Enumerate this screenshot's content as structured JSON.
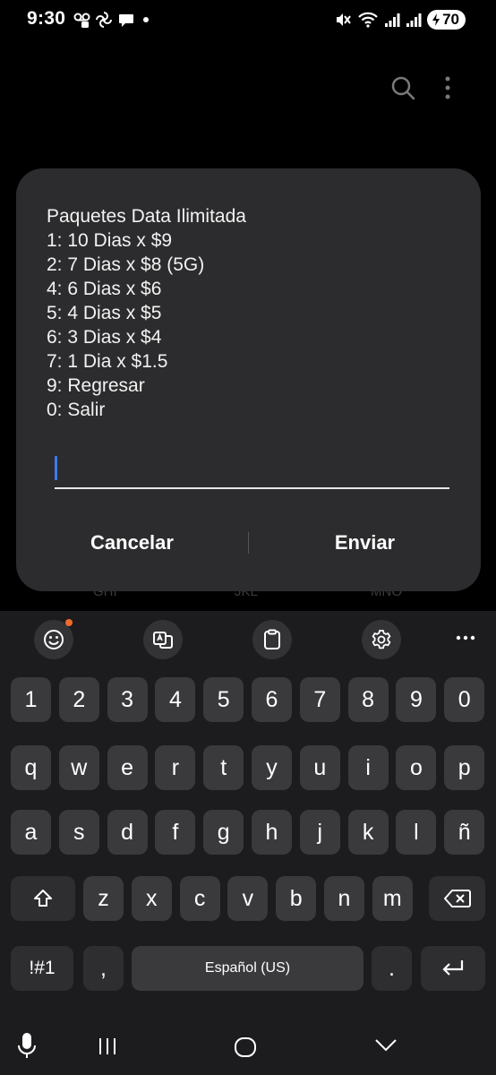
{
  "status_bar": {
    "time": "9:30",
    "battery_level": "70",
    "icons": [
      "voicemail-icon",
      "pinwheel-icon",
      "chat-bubble-icon",
      "dot-icon",
      "mute-icon",
      "wifi-icon",
      "signal-icon",
      "signal-icon",
      "battery-charging-icon"
    ]
  },
  "app_header": {
    "icons": [
      "search-icon",
      "more-vertical-icon"
    ]
  },
  "dialog": {
    "lines": [
      "Paquetes Data Ilimitada",
      "1: 10 Dias x $9",
      "2: 7 Dias x $8 (5G)",
      "4: 6 Dias x $6",
      "5: 4 Dias x $5",
      "6: 3 Dias x $4",
      "7: 1 Dia x $1.5",
      "9: Regresar",
      "0: Salir"
    ],
    "input_value": "",
    "cancel_label": "Cancelar",
    "send_label": "Enviar"
  },
  "background_dialpad": {
    "letters": [
      "GHI",
      "JKL",
      "MNO"
    ]
  },
  "keyboard": {
    "toolbar": [
      "emoji-icon",
      "translate-icon",
      "clipboard-icon",
      "gear-icon",
      "more-horizontal-icon"
    ],
    "row_numbers": [
      "1",
      "2",
      "3",
      "4",
      "5",
      "6",
      "7",
      "8",
      "9",
      "0"
    ],
    "row1": [
      "q",
      "w",
      "e",
      "r",
      "t",
      "y",
      "u",
      "i",
      "o",
      "p"
    ],
    "row2": [
      "a",
      "s",
      "d",
      "f",
      "g",
      "h",
      "j",
      "k",
      "l",
      "ñ"
    ],
    "row3": [
      "z",
      "x",
      "c",
      "v",
      "b",
      "n",
      "m"
    ],
    "symbols_label": "!#1",
    "comma_label": ",",
    "space_label": "Español (US)",
    "period_label": "."
  },
  "colors": {
    "background": "#000000",
    "dialog": "#2c2c2e",
    "keyboard": "#1c1c1e",
    "key": "#3a3a3c",
    "caret": "#3d7bf0",
    "notification_dot": "#f06a2a"
  }
}
